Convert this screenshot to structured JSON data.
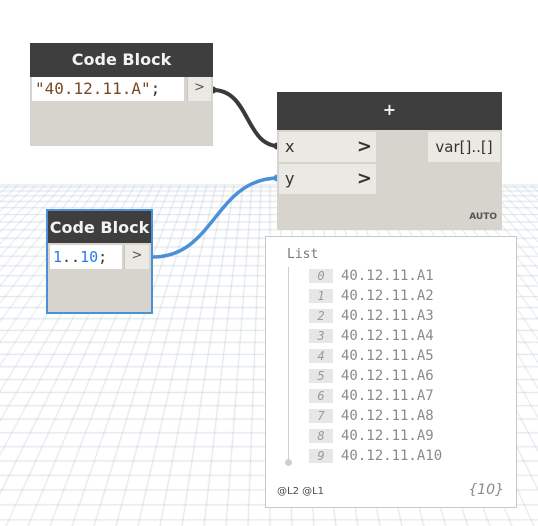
{
  "canvas": {
    "wire_color": "#3a3a3a",
    "selected_wire_color": "#4a90d9"
  },
  "code_block_1": {
    "title": "Code Block",
    "code": "\"40.12.11.A\"",
    "terminator": ";",
    "output_port": ">"
  },
  "code_block_2": {
    "title": "Code Block",
    "range_start": "1",
    "range_op": "..",
    "range_end": "10",
    "terminator": ";",
    "output_port": ">"
  },
  "add_node": {
    "title": "+",
    "inputs": [
      {
        "label": "x"
      },
      {
        "label": "y"
      }
    ],
    "input_arrow": ">",
    "output": "var[]..[]",
    "lacing": "AUTO"
  },
  "preview": {
    "title": "List",
    "items": [
      {
        "index": "0",
        "value": "40.12.11.A1"
      },
      {
        "index": "1",
        "value": "40.12.11.A2"
      },
      {
        "index": "2",
        "value": "40.12.11.A3"
      },
      {
        "index": "3",
        "value": "40.12.11.A4"
      },
      {
        "index": "4",
        "value": "40.12.11.A5"
      },
      {
        "index": "5",
        "value": "40.12.11.A6"
      },
      {
        "index": "6",
        "value": "40.12.11.A7"
      },
      {
        "index": "7",
        "value": "40.12.11.A8"
      },
      {
        "index": "8",
        "value": "40.12.11.A9"
      },
      {
        "index": "9",
        "value": "40.12.11.A10"
      }
    ],
    "levels": "@L2 @L1",
    "count": "{10}"
  }
}
